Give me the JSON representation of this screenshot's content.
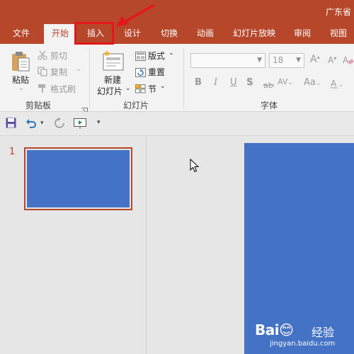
{
  "title": "广东省",
  "tabs": [
    {
      "label": "文件"
    },
    {
      "label": "开始"
    },
    {
      "label": "插入"
    },
    {
      "label": "设计"
    },
    {
      "label": "切换"
    },
    {
      "label": "动画"
    },
    {
      "label": "幻灯片放映"
    },
    {
      "label": "审阅"
    },
    {
      "label": "视图"
    }
  ],
  "active_tab": "开始",
  "highlighted_tab": "插入",
  "ribbon": {
    "clipboard": {
      "paste": "粘贴",
      "cut": "剪切",
      "copy": "复制",
      "format_painter": "格式刷",
      "group_label": "剪贴板"
    },
    "slides": {
      "new_slide_line1": "新建",
      "new_slide_line2": "幻灯片",
      "layout": "版式",
      "reset": "重置",
      "section": "节",
      "group_label": "幻灯片"
    },
    "font": {
      "font_name_value": "",
      "font_size_value": "18",
      "bold": "B",
      "italic": "I",
      "underline": "U",
      "shadow": "S",
      "char_spacing": "AV",
      "change_case": "Aa",
      "increase_size": "A",
      "decrease_size": "A",
      "group_label": "字体"
    }
  },
  "thumbnails": [
    {
      "number": "1"
    }
  ],
  "colors": {
    "accent": "#b7472a",
    "slide_fill": "#4472c4",
    "annotation_red": "#e3161b"
  },
  "watermark": {
    "logo": "Bai😊",
    "brand": "经验",
    "url": "jingyan.baidu.com"
  }
}
